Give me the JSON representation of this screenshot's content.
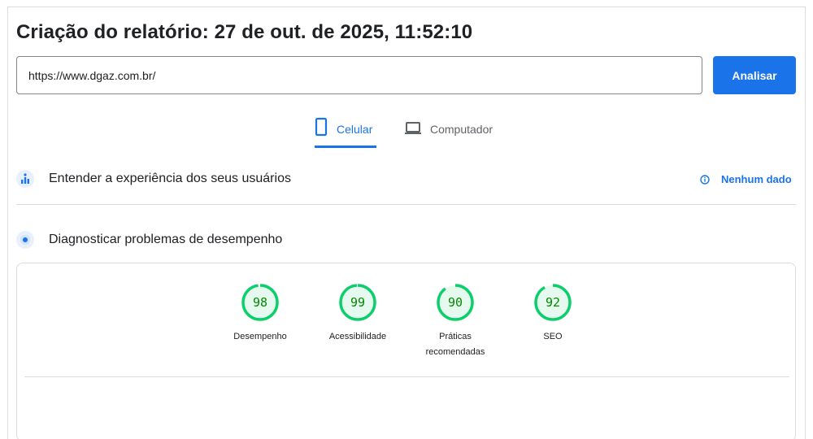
{
  "report": {
    "title": "Criação do relatório: 27 de out. de 2025, 11:52:10"
  },
  "url_input": {
    "value": "https://www.dgaz.com.br/"
  },
  "analyze_button": {
    "label": "Analisar"
  },
  "tabs": [
    {
      "label": "Celular",
      "icon": "mobile-icon",
      "active": true
    },
    {
      "label": "Computador",
      "icon": "laptop-icon",
      "active": false
    }
  ],
  "sections": {
    "cwv": {
      "label": "Entender a experiência dos seus usuários",
      "icon": "users-experience-icon"
    },
    "diagnose": {
      "label": "Diagnosticar problemas de desempenho",
      "icon": "lighthouse-icon"
    }
  },
  "no_data": {
    "label": "Nenhum dado",
    "icon": "info-icon"
  },
  "scores": [
    {
      "value": 98,
      "label": "Desempenho"
    },
    {
      "value": 99,
      "label": "Acessibilidade"
    },
    {
      "value": 90,
      "label": "Práticas recomendadas"
    },
    {
      "value": 92,
      "label": "SEO"
    }
  ],
  "colors": {
    "accent": "#1a73e8",
    "pass_stroke": "#0cce6b",
    "pass_fill": "#e6f9ee",
    "pass_text": "#008800"
  }
}
